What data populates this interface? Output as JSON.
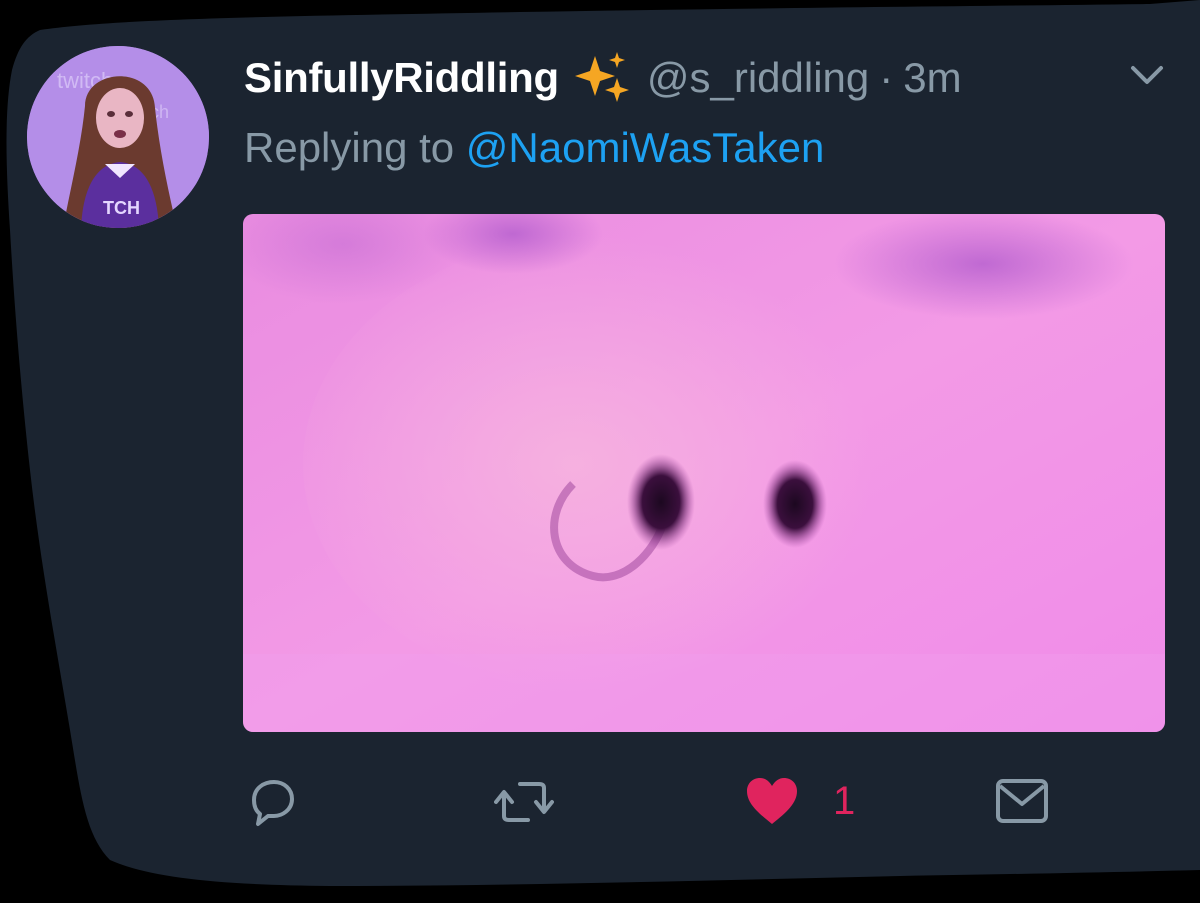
{
  "tweet": {
    "display_name": "SinfullyRiddling",
    "handle": "@s_riddling",
    "separator": "·",
    "time": "3m",
    "reply_prefix": "Replying to",
    "reply_to": "@NaomiWasTaken"
  },
  "actions": {
    "like_count": "1"
  },
  "icons": {
    "name_badge": "sparkles-icon",
    "menu": "chevron-down-icon",
    "reply": "reply-icon",
    "retweet": "retweet-icon",
    "like": "heart-icon",
    "message": "envelope-icon"
  },
  "colors": {
    "card_background": "#1b2430",
    "secondary_text": "#8899a6",
    "link": "#1da1f2",
    "like": "#e0245e",
    "sparkle": "#f5a623"
  }
}
